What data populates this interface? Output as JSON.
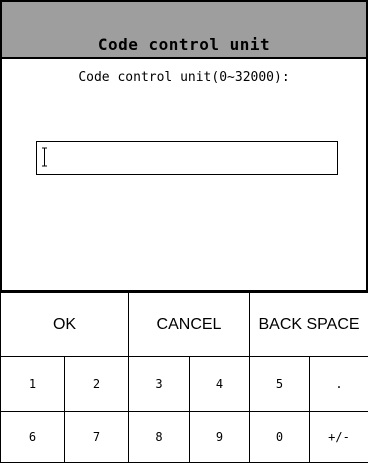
{
  "dialog": {
    "title": "Code control unit",
    "prompt": "Code control unit(0~32000):",
    "input": {
      "value": "",
      "placeholder": ""
    }
  },
  "keypad": {
    "ok": "OK",
    "cancel": "CANCEL",
    "backspace": "BACK SPACE",
    "keys": {
      "k1": "1",
      "k2": "2",
      "k3": "3",
      "k4": "4",
      "k5": "5",
      "dot": ".",
      "k6": "6",
      "k7": "7",
      "k8": "8",
      "k9": "9",
      "k0": "0",
      "plusminus": "+/-"
    }
  },
  "colors": {
    "titlebar_bg": "#9e9e9e",
    "border": "#000000",
    "background": "#ffffff"
  }
}
